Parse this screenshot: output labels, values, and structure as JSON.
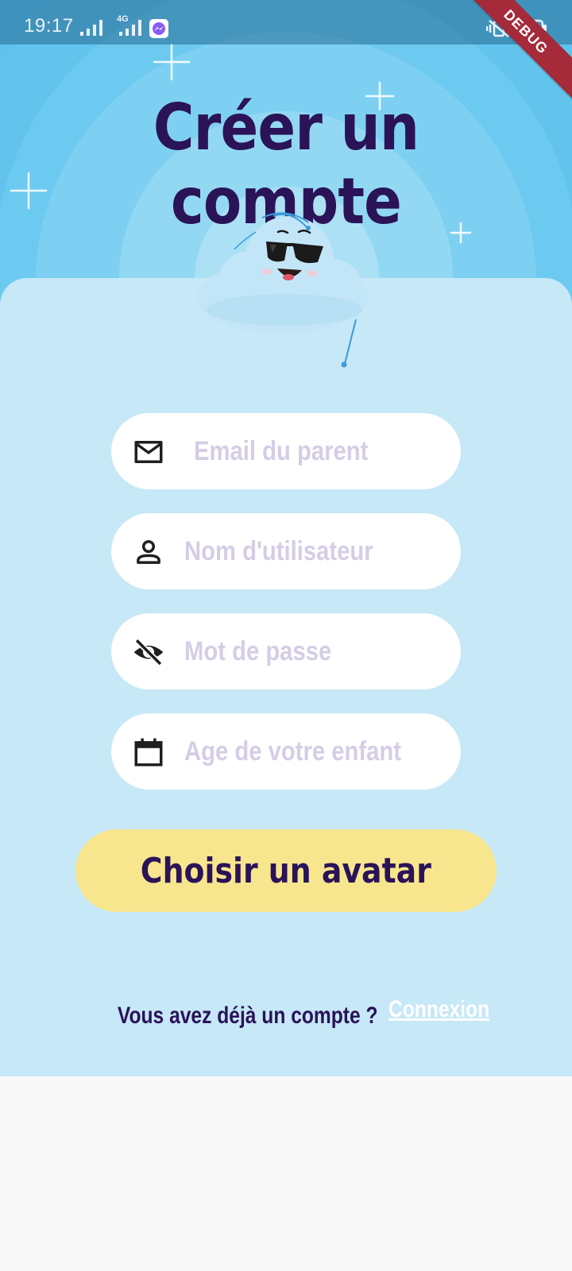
{
  "status_bar": {
    "time": "19:17",
    "network": "4G",
    "icons": [
      "signal-icon",
      "signal-4g-icon",
      "messenger-icon",
      "vibrate-icon",
      "battery-icon"
    ]
  },
  "debug_banner": "DEBUG",
  "title": "Créer un compte",
  "mascot": "cloud-sunglasses-mascot",
  "form": {
    "email_placeholder": "Email du parent",
    "username_placeholder": "Nom d'utilisateur",
    "password_placeholder": "Mot de passe",
    "age_placeholder": "Age de votre enfant",
    "email_icon": "mail-icon",
    "username_icon": "person-icon",
    "password_icon": "eye-off-icon",
    "age_icon": "calendar-icon"
  },
  "cta_label": "Choisir un avatar",
  "login": {
    "question": "Vous avez déjà un compte ?",
    "link": "Connexion"
  },
  "colors": {
    "sky": "#5ec3ec",
    "card": "#c6e8f7",
    "title": "#2b1358",
    "button": "#f8e68f",
    "placeholder": "#d5cde6"
  }
}
